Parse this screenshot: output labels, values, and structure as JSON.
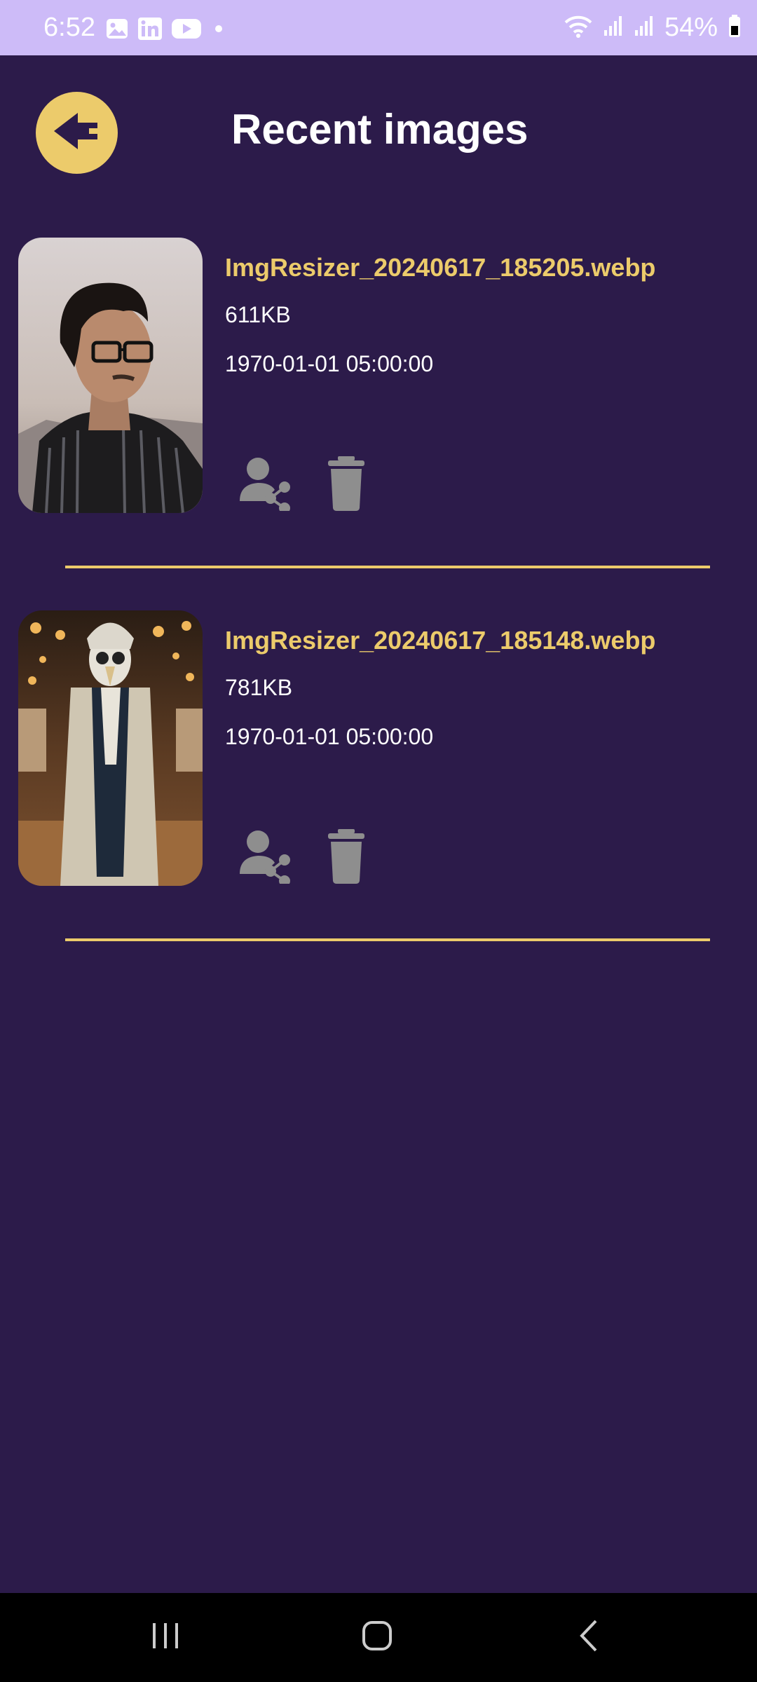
{
  "status_bar": {
    "time": "6:52",
    "battery": "54%",
    "left_icons": [
      "gallery-icon",
      "linkedin-icon",
      "youtube-icon",
      "dot-icon"
    ],
    "right_icons": [
      "wifi-icon",
      "signal-icon",
      "signal-icon",
      "battery-icon"
    ]
  },
  "header": {
    "title": "Recent images",
    "back_icon": "back-arrow-icon"
  },
  "items": [
    {
      "name": "ImgResizer_20240617_185205.webp",
      "size": "611KB",
      "date": "1970-01-01 05:00:00",
      "actions": [
        "share-icon",
        "delete-icon"
      ]
    },
    {
      "name": "ImgResizer_20240617_185148.webp",
      "size": "781KB",
      "date": "1970-01-01 05:00:00",
      "actions": [
        "share-icon",
        "delete-icon"
      ]
    }
  ],
  "nav": {
    "buttons": [
      "recents-icon",
      "home-icon",
      "back-icon"
    ]
  },
  "colors": {
    "background": "#2c1b4a",
    "status_bar": "#cdbbf8",
    "accent": "#eccb6b",
    "icon_gray": "#8e8e8e",
    "text": "#ffffff"
  }
}
